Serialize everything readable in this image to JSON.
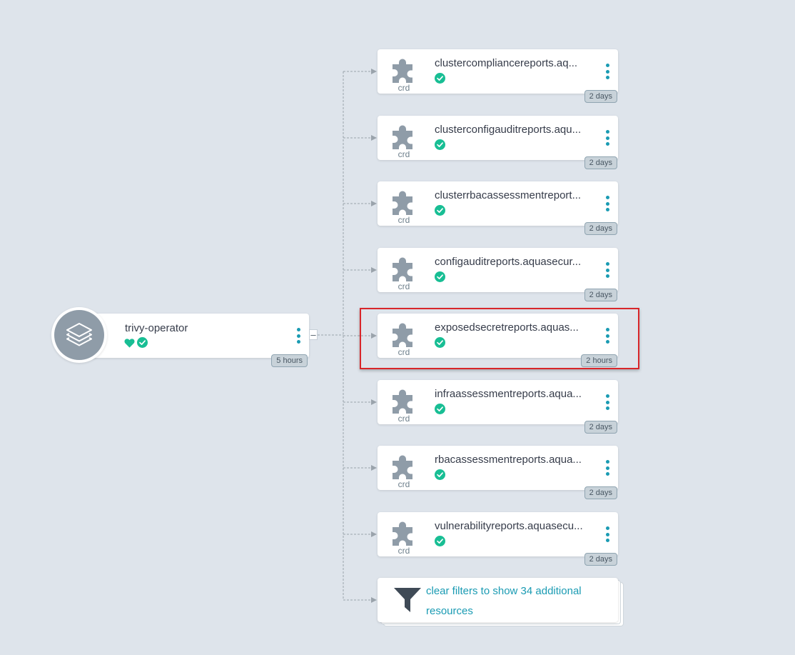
{
  "root": {
    "name": "trivy-operator",
    "age": "5 hours",
    "health_icon": "heart-icon",
    "sync_icon": "check-circle-icon",
    "icon": "layers-icon",
    "collapse_label": "–"
  },
  "resources": [
    {
      "name": "clustercompliancereports.aq...",
      "kind": "crd",
      "age": "2 days"
    },
    {
      "name": "clusterconfigauditreports.aqu...",
      "kind": "crd",
      "age": "2 days"
    },
    {
      "name": "clusterrbacassessmentreport...",
      "kind": "crd",
      "age": "2 days"
    },
    {
      "name": "configauditreports.aquasecur...",
      "kind": "crd",
      "age": "2 days"
    },
    {
      "name": "exposedsecretreports.aquas...",
      "kind": "crd",
      "age": "2 hours"
    },
    {
      "name": "infraassessmentreports.aqua...",
      "kind": "crd",
      "age": "2 days"
    },
    {
      "name": "rbacassessmentreports.aqua...",
      "kind": "crd",
      "age": "2 days"
    },
    {
      "name": "vulnerabilityreports.aquasecu...",
      "kind": "crd",
      "age": "2 days"
    }
  ],
  "filter_node": {
    "text": "clear filters to show 34 additional resources",
    "icon": "filter-icon"
  },
  "colors": {
    "background": "#dee4eb",
    "accent": "#1a9bb3",
    "healthy": "#18be94",
    "icon_gray": "#8f9ca8",
    "highlight": "#d8262a"
  }
}
